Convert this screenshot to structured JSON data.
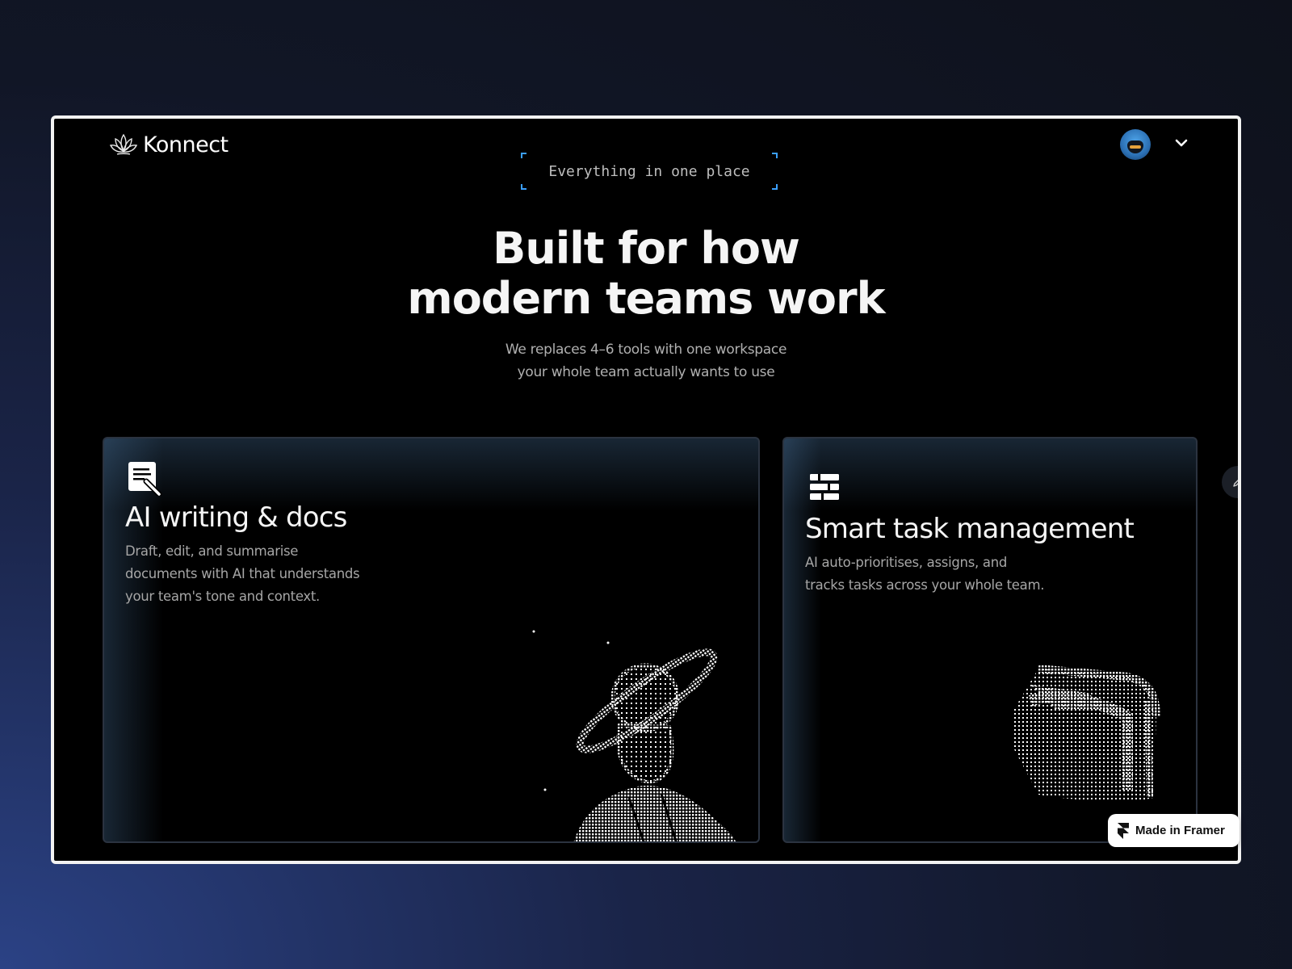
{
  "header": {
    "brand": "Konnect",
    "logo_icon": "lotus-icon",
    "avatar_icon": "user-avatar",
    "menu_icon": "chevron-down-icon"
  },
  "hero": {
    "eyebrow": "Everything in one place",
    "headline_line1": "Built for how",
    "headline_line2": "modern teams work",
    "subhead_line1": "We replaces 4–6 tools with one workspace",
    "subhead_line2": "your whole team actually wants to use"
  },
  "features": [
    {
      "icon": "document-pen-icon",
      "title": "AI writing & docs",
      "desc_line1": "Draft, edit, and summarise",
      "desc_line2": "documents with AI that understands",
      "desc_line3": "your team's tone and context."
    },
    {
      "icon": "task-list-icon",
      "title": "Smart task management",
      "desc_line1": "AI auto-prioritises, assigns, and",
      "desc_line2": "tracks tasks across your whole team."
    }
  ],
  "badge": {
    "label": "Made in Framer",
    "icon": "framer-icon"
  },
  "colors": {
    "accent": "#3ba0ff",
    "frame_bg": "#000000",
    "card_border": "#2b3340"
  }
}
